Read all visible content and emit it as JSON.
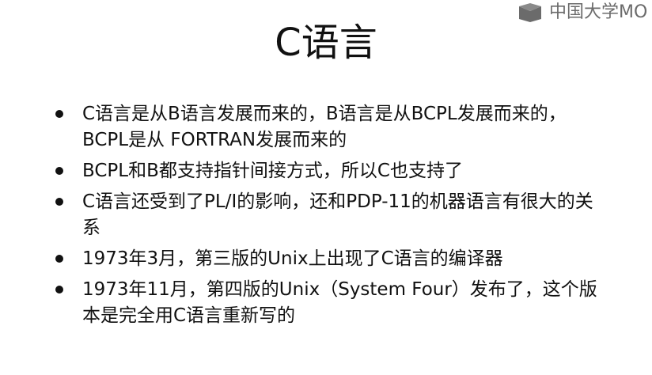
{
  "watermark": {
    "text": "中国大学MO",
    "icon": "mooc-logo-icon"
  },
  "slide": {
    "title": "C语言",
    "bullets": [
      "C语言是从B语言发展而来的，B语言是从BCPL发展而来的，BCPL是从 FORTRAN发展而来的",
      "BCPL和B都支持指针间接方式，所以C也支持了",
      "C语言还受到了PL/I的影响，还和PDP-11的机器语言有很大的关系",
      "1973年3月，第三版的Unix上出现了C语言的编译器",
      "1973年11月，第四版的Unix（System Four）发布了，这个版本是完全用C语言重新写的"
    ]
  }
}
